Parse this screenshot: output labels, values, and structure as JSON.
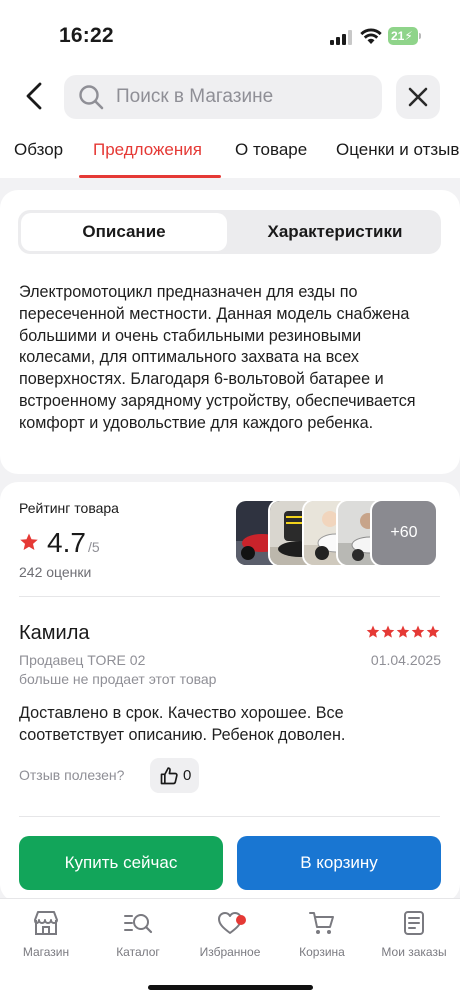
{
  "status_bar": {
    "time": "16:22",
    "battery": "21"
  },
  "header": {
    "search_placeholder": "Поиск в Магазине",
    "tabs": [
      {
        "label": "Обзор"
      },
      {
        "label": "Предложения"
      },
      {
        "label": "О товаре"
      },
      {
        "label": "Оценки и отзывы"
      }
    ],
    "active_tab": "Предложения"
  },
  "description": {
    "segments": [
      {
        "label": "Описание"
      },
      {
        "label": "Характеристики"
      }
    ],
    "active_segment": "Описание",
    "text": "Электромотоцикл предназначен для езды по пересеченной местности. Данная модель снабжена большими и очень стабильными резиновыми колесами, для оптимального захвата на всех поверхностях. Благодаря 6-вольтовой батарее и встроенному зарядному устройству, обеспечивается комфорт и удовольствие для каждого ребенка."
  },
  "rating": {
    "label": "Рейтинг товара",
    "value": "4.7",
    "max": "/5",
    "count": "242 оценки",
    "more_photos": "+60"
  },
  "review": {
    "author": "Камила",
    "stars": 5,
    "seller": "Продавец TORE 02",
    "date": "01.04.2025",
    "seller_note": "больше не продает этот товар",
    "text": "Доставлено в срок. Качество хорошее. Все соответствует описанию. Ребенок доволен.",
    "helpful_label": "Отзыв полезен?",
    "likes": "0"
  },
  "actions": {
    "buy_now": "Купить сейчас",
    "add_to_cart": "В корзину"
  },
  "bottom_nav": [
    {
      "label": "Магазин",
      "icon": "store-icon"
    },
    {
      "label": "Каталог",
      "icon": "catalog-search-icon"
    },
    {
      "label": "Избранное",
      "icon": "heart-icon"
    },
    {
      "label": "Корзина",
      "icon": "cart-icon"
    },
    {
      "label": "Мои заказы",
      "icon": "orders-icon"
    }
  ],
  "colors": {
    "accent": "#e53935",
    "buy_now": "#12a55a",
    "add_to_cart": "#1976d2",
    "battery": "#8fd48a"
  }
}
